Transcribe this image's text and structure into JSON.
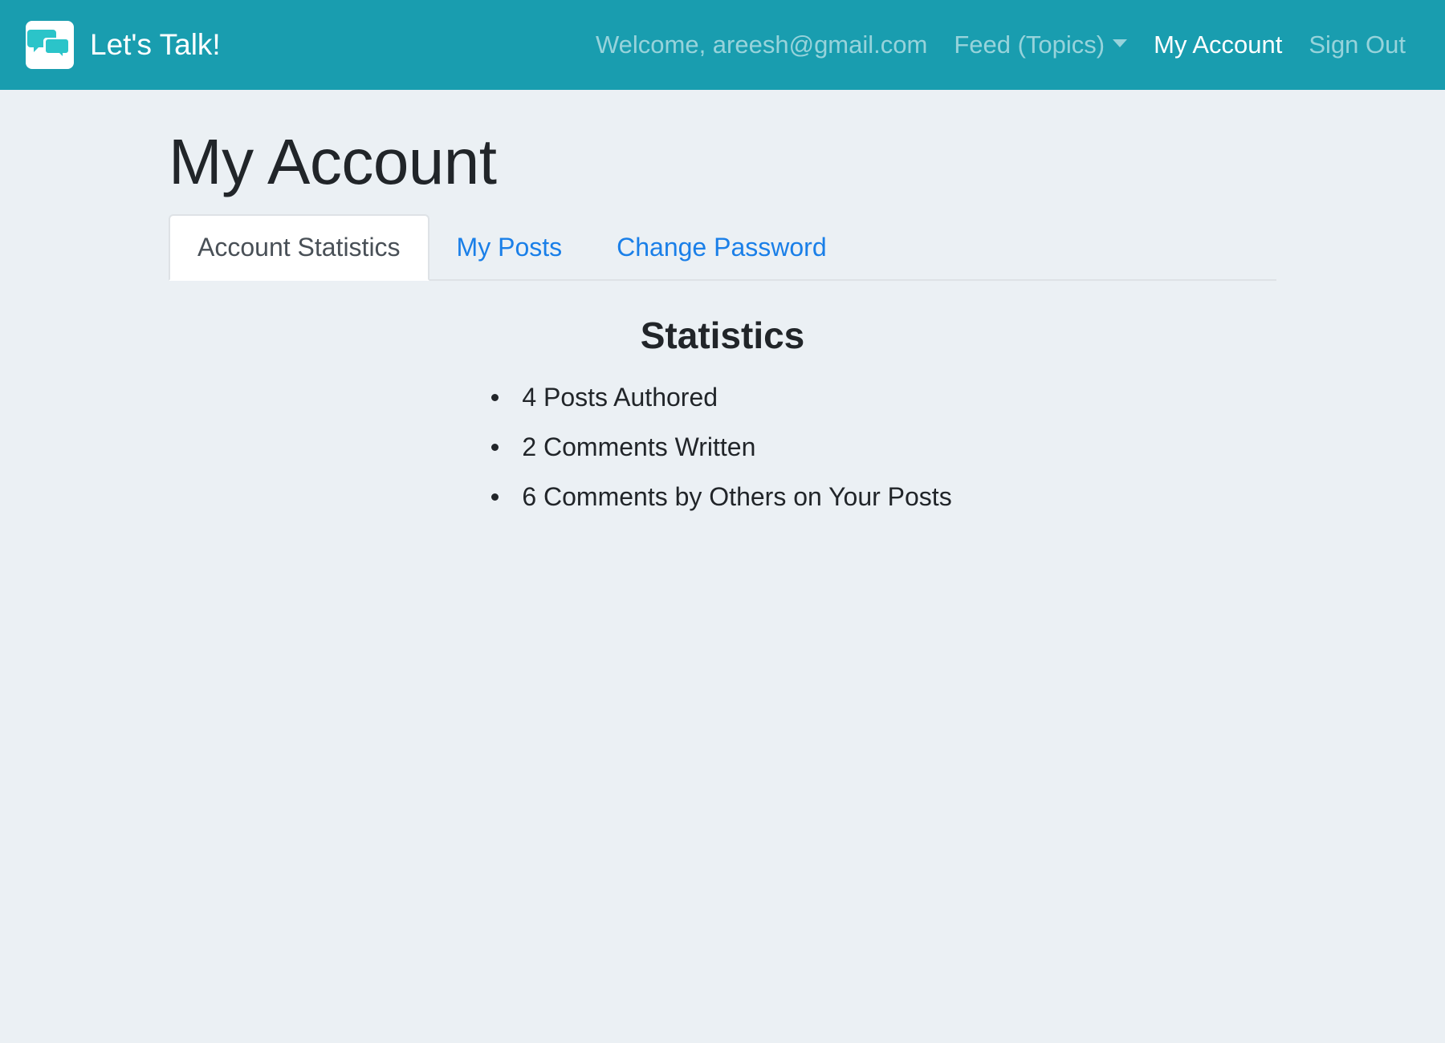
{
  "navbar": {
    "brand": "Let's Talk!",
    "welcome": "Welcome, areesh@gmail.com",
    "feed": "Feed (Topics)",
    "my_account": "My Account",
    "sign_out": "Sign Out"
  },
  "page": {
    "title": "My Account"
  },
  "tabs": [
    {
      "label": "Account Statistics",
      "active": true
    },
    {
      "label": "My Posts",
      "active": false
    },
    {
      "label": "Change Password",
      "active": false
    }
  ],
  "statistics": {
    "heading": "Statistics",
    "items": [
      "4 Posts Authored",
      "2 Comments Written",
      "6 Comments by Others on Your Posts"
    ]
  },
  "colors": {
    "navbar": "#199daf",
    "background": "#ebf0f4",
    "link": "#1a7fe8",
    "logo_bubble": "#2bc4c9"
  },
  "icons": {
    "brand_logo": "chat-bubbles-icon",
    "feed_caret": "caret-down-icon"
  }
}
